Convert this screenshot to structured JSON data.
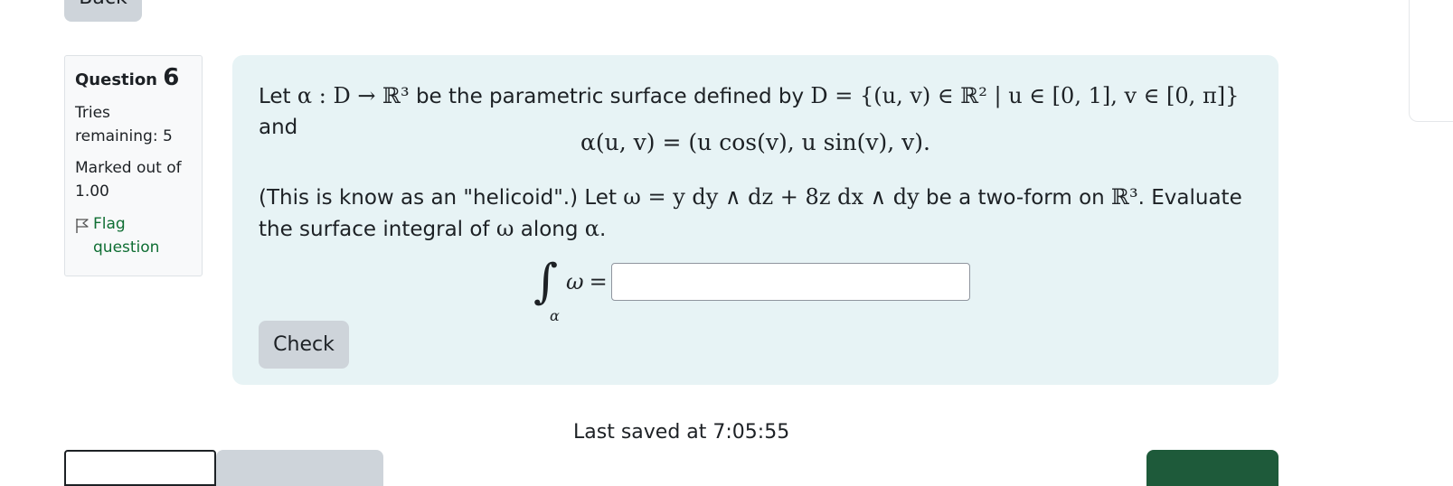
{
  "nav": {
    "back_label": "Back"
  },
  "question_info": {
    "label": "Question",
    "number": "6",
    "tries": "Tries remaining: 5",
    "marked": "Marked out of 1.00",
    "flag_label": "Flag question",
    "flag_icon": "flag-outline-icon"
  },
  "question": {
    "line1_let": "Let",
    "line1_map": "α : D → ℝ³",
    "line1_mid": "be the parametric surface defined by",
    "line1_domain": "D = {(u, v) ∈ ℝ² | u ∈ [0, 1], v ∈ [0, π]}",
    "line1_and": "and",
    "display_formula": "α(u, v) = (u cos(v), u sin(v), v).",
    "para2_prefix": "(This is know as an \"helicoid\".) Let",
    "para2_form": "ω = y dy ∧ dz + 8z dx ∧ dy",
    "para2_mid": "be a two-form on",
    "para2_space": "ℝ³",
    "para2_suffix": ". Evaluate the surface integral of",
    "para2_omega": "ω",
    "para2_along": "along",
    "para2_alpha": "α",
    "para2_end": ".",
    "integral_sign": "∫",
    "integral_sub": "α",
    "integral_omega": "ω",
    "integral_eq": "=",
    "answer_value": "",
    "answer_placeholder": ""
  },
  "actions": {
    "check_label": "Check"
  },
  "footer": {
    "saved_text": "Last saved at 7:05:55"
  },
  "colors": {
    "question_bg": "#e7f3f5",
    "button_grey": "#ced4da",
    "link_green": "#0f6e33",
    "next_button": "#1e5a3a"
  }
}
